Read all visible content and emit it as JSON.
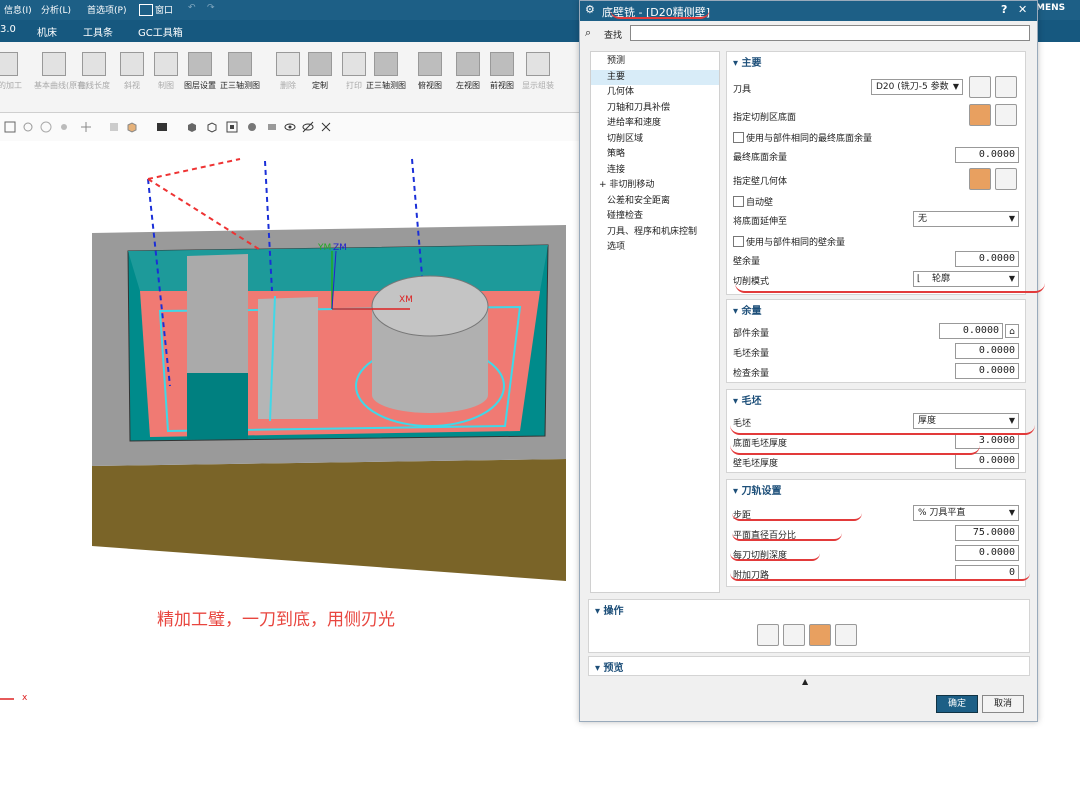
{
  "topbar": {
    "info": "信息(I)",
    "analysis": "分析(L)",
    "prefs": "首选项(P)",
    "window": "窗口",
    "brand": "MENS"
  },
  "menubar": {
    "tabs": [
      "3.0",
      "机床",
      "工具条",
      "GC工具箱"
    ]
  },
  "ribbon": {
    "items": [
      {
        "label": "壁的加工",
        "dim": true
      },
      {
        "label": "基本曲线(原有)",
        "dim": true
      },
      {
        "label": "曲线长度",
        "dim": true
      },
      {
        "label": "斜视",
        "dim": true
      },
      {
        "label": "制图",
        "dim": true
      },
      {
        "label": "图层设置",
        "dim": false
      },
      {
        "label": "正三轴测图",
        "dim": false
      },
      {
        "label": "删除",
        "dim": true
      },
      {
        "label": "定制",
        "dim": false
      },
      {
        "label": "打印",
        "dim": true
      },
      {
        "label": "正三轴测图",
        "dim": false
      },
      {
        "label": "俯视图",
        "dim": false
      },
      {
        "label": "左视图",
        "dim": false
      },
      {
        "label": "前视图",
        "dim": false
      },
      {
        "label": "显示组装",
        "dim": true
      }
    ]
  },
  "viewport": {
    "caption": "精加工璧，一刀到底，用侧刃光",
    "axis_xm": "XM",
    "axis_ym": "YM",
    "axis_zm": "ZM",
    "axis_x": "x"
  },
  "dialog": {
    "title": "底壁铣 - [D20精侧壁]",
    "help": "?",
    "close": "✕",
    "search_label": "查找",
    "nav": [
      "预测",
      "主要",
      "几何体",
      "刀轴和刀具补偿",
      "进给率和速度",
      "切削区域",
      "策略",
      "连接",
      "非切削移动",
      "公差和安全距离",
      "碰撞检查",
      "刀具、程序和机床控制",
      "选项"
    ],
    "main": {
      "header": "主要",
      "tool_label": "刀具",
      "tool_value": "D20 (铣刀-5 参数",
      "floor_label": "指定切削区底面",
      "use_floor_stock": "使用与部件相同的最终底面余量",
      "final_floor_label": "最终底面余量",
      "final_floor_value": "0.0000",
      "wall_geom_label": "指定壁几何体",
      "auto_wall": "自动壁",
      "extend_label": "将底面延伸至",
      "extend_value": "无",
      "use_wall_stock": "使用与部件相同的壁余量",
      "wall_stock_label": "壁余量",
      "wall_stock_value": "0.0000",
      "cut_pattern_label": "切削模式",
      "cut_pattern_value": "轮廓"
    },
    "stock": {
      "header": "余量",
      "part_label": "部件余量",
      "part_value": "0.0000",
      "blank_label": "毛坯余量",
      "blank_value": "0.0000",
      "check_label": "检查余量",
      "check_value": "0.0000"
    },
    "blank": {
      "header": "毛坯",
      "blank_label": "毛坯",
      "blank_value": "厚度",
      "floor_thk_label": "底面毛坯厚度",
      "floor_thk_value": "3.0000",
      "wall_thk_label": "壁毛坯厚度",
      "wall_thk_value": "0.0000"
    },
    "path": {
      "header": "刀轨设置",
      "step_label": "步距",
      "step_value": "% 刀具平直",
      "pct_label": "平面直径百分比",
      "pct_value": "75.0000",
      "depth_label": "每刀切削深度",
      "depth_value": "0.0000",
      "extra_label": "附加刀路",
      "extra_value": "0"
    },
    "ops_header": "操作",
    "preview_header": "预览",
    "ok": "确定",
    "cancel": "取消"
  }
}
